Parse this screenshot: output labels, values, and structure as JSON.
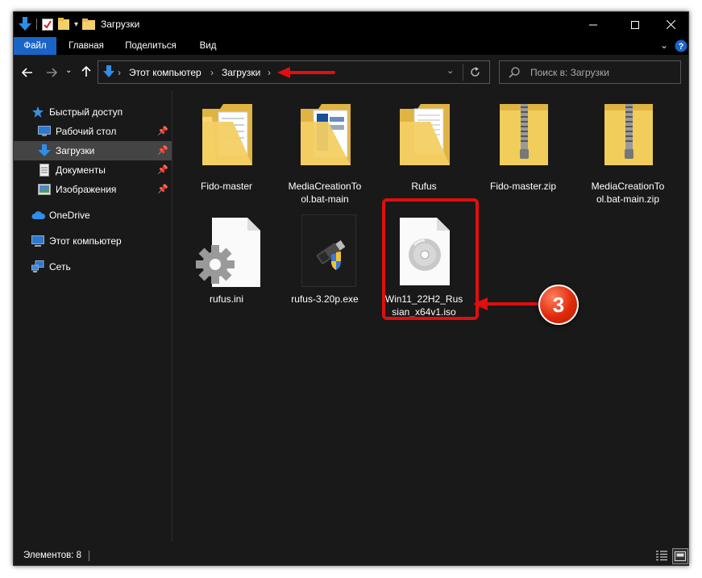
{
  "window": {
    "title": "Загрузки"
  },
  "ribbon": {
    "tabs": [
      "Файл",
      "Главная",
      "Поделиться",
      "Вид"
    ]
  },
  "address": {
    "crumbs": [
      "Этот компьютер",
      "Загрузки"
    ]
  },
  "search": {
    "placeholder": "Поиск в: Загрузки"
  },
  "sidebar": {
    "items": [
      {
        "label": "Быстрый доступ",
        "icon": "star-icon"
      },
      {
        "label": "Рабочий стол",
        "icon": "desktop-icon",
        "pinned": true
      },
      {
        "label": "Загрузки",
        "icon": "download-arrow-icon",
        "pinned": true,
        "selected": true
      },
      {
        "label": "Документы",
        "icon": "documents-icon",
        "pinned": true
      },
      {
        "label": "Изображения",
        "icon": "pictures-icon",
        "pinned": true
      },
      {
        "label": "OneDrive",
        "icon": "cloud-icon"
      },
      {
        "label": "Этот компьютер",
        "icon": "computer-icon"
      },
      {
        "label": "Сеть",
        "icon": "network-icon"
      }
    ]
  },
  "files": [
    {
      "line1": "Fido-master",
      "line2": "",
      "type": "folder"
    },
    {
      "line1": "MediaCreationTo",
      "line2": "ol.bat-main",
      "type": "folder"
    },
    {
      "line1": "Rufus",
      "line2": "",
      "type": "folder"
    },
    {
      "line1": "Fido-master.zip",
      "line2": "",
      "type": "zip"
    },
    {
      "line1": "MediaCreationTo",
      "line2": "ol.bat-main.zip",
      "type": "zip"
    },
    {
      "line1": "rufus.ini",
      "line2": "",
      "type": "ini"
    },
    {
      "line1": "rufus-3.20p.exe",
      "line2": "",
      "type": "exe"
    },
    {
      "line1": "Win11_22H2_Rus",
      "line2": "sian_x64v1.iso",
      "type": "iso"
    }
  ],
  "status": {
    "items_count": "Элементов: 8"
  },
  "annotation": {
    "step": "3",
    "color": "#e00e0e"
  }
}
